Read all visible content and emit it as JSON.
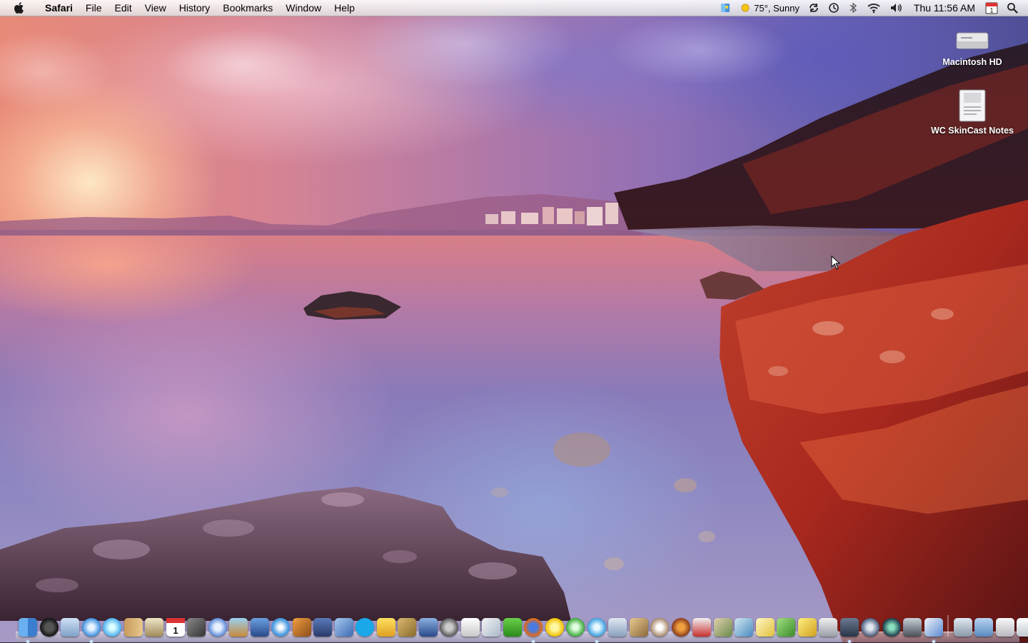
{
  "menubar": {
    "app_name": "Safari",
    "menus": [
      "File",
      "Edit",
      "View",
      "History",
      "Bookmarks",
      "Window",
      "Help"
    ],
    "weather": "75°, Sunny",
    "clock": "Thu 11:56 AM",
    "calendar_day": "1",
    "status_icons": [
      "finder-flag-icon",
      "sun-icon",
      "sync-icon",
      "time-machine-icon",
      "bluetooth-icon",
      "wifi-icon",
      "volume-icon",
      "calendar-icon",
      "spotlight-icon"
    ]
  },
  "desktop": {
    "icons": [
      {
        "label": "Macintosh HD",
        "icon": "hard-drive-icon"
      },
      {
        "label": "WC SkinCast Notes",
        "icon": "document-icon"
      }
    ]
  },
  "dock": {
    "item_count": 48,
    "calendar_day": "1"
  }
}
